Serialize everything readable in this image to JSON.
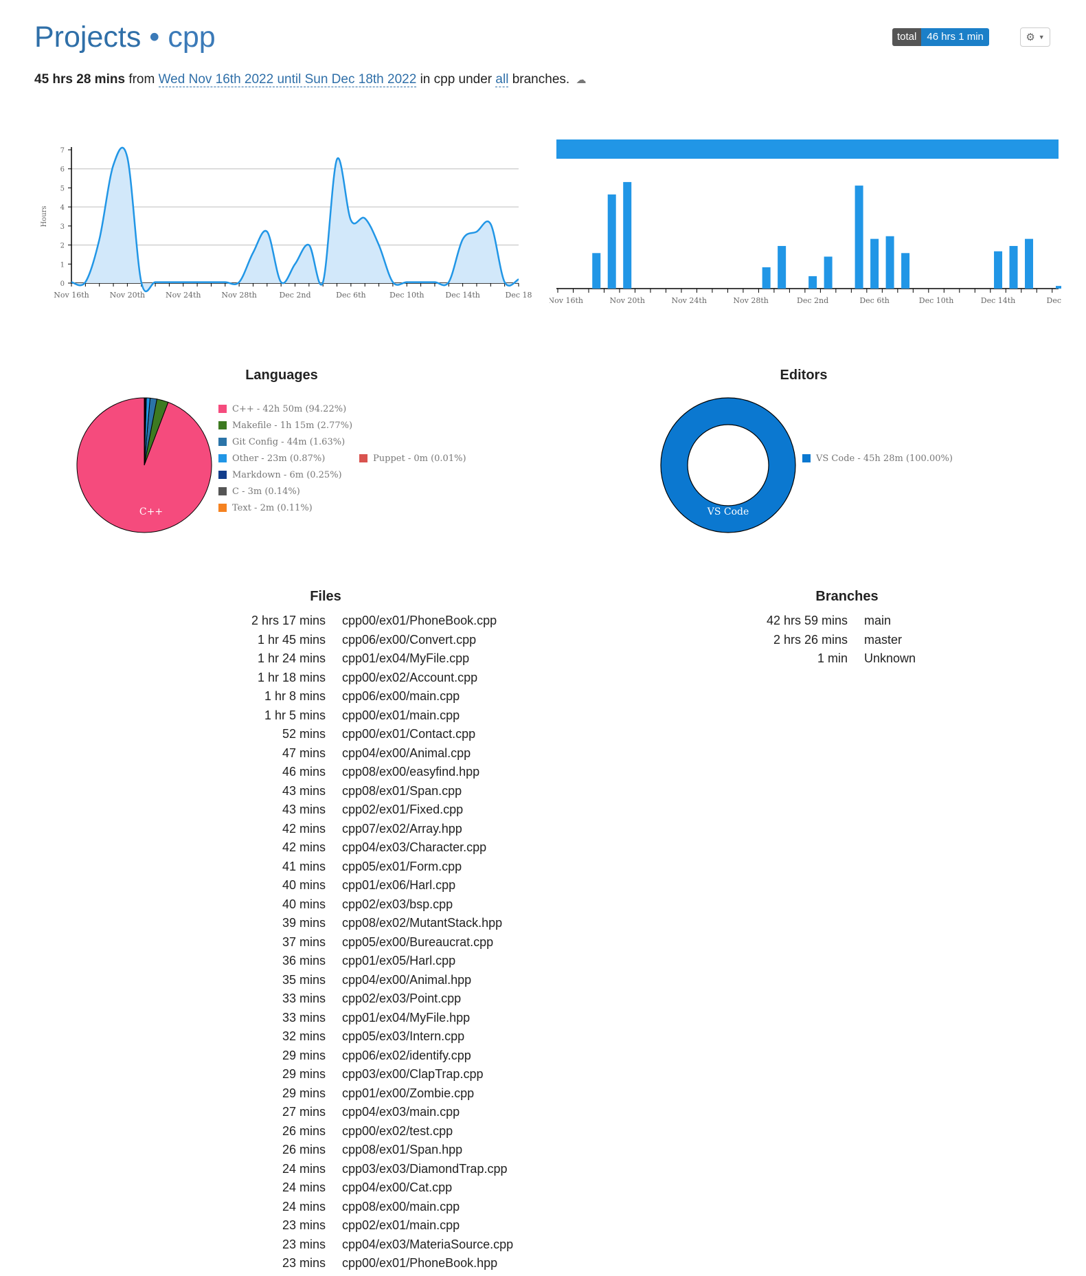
{
  "header": {
    "title_prefix": "Projects",
    "separator": "•",
    "project": "cpp",
    "total_label": "total",
    "total_value": "46 hrs 1 min"
  },
  "summary": {
    "duration": "45 hrs 28 mins",
    "from_word": "from",
    "range": "Wed Nov 16th 2022 until Sun Dec 18th 2022",
    "in_text": "in cpp under",
    "branches_link": "all",
    "tail": "branches."
  },
  "chart_data": [
    {
      "type": "area",
      "ylabel": "Hours",
      "ylim": [
        0,
        7
      ],
      "yticks": [
        0,
        1,
        2,
        3,
        4,
        5,
        6,
        7
      ],
      "x_tick_labels": [
        "Nov 16th",
        "Nov 20th",
        "Nov 24th",
        "Nov 28th",
        "Dec 2nd",
        "Dec 6th",
        "Dec 10th",
        "Dec 14th",
        "Dec 18"
      ],
      "x": [
        "Nov 16",
        "Nov 17",
        "Nov 18",
        "Nov 19",
        "Nov 20",
        "Nov 21",
        "Nov 22",
        "Nov 23",
        "Nov 24",
        "Nov 25",
        "Nov 26",
        "Nov 27",
        "Nov 28",
        "Nov 29",
        "Nov 30",
        "Dec 1",
        "Dec 2",
        "Dec 3",
        "Dec 4",
        "Dec 5",
        "Dec 6",
        "Dec 7",
        "Dec 8",
        "Dec 9",
        "Dec 10",
        "Dec 11",
        "Dec 12",
        "Dec 13",
        "Dec 14",
        "Dec 15",
        "Dec 16",
        "Dec 17",
        "Dec 18"
      ],
      "values": [
        0.05,
        0.05,
        2.3,
        6.2,
        6.6,
        0.05,
        0.05,
        0.05,
        0.05,
        0.05,
        0.05,
        0.05,
        0.05,
        1.6,
        2.7,
        0.05,
        1.0,
        2.0,
        0.05,
        6.5,
        3.3,
        3.4,
        2.0,
        0.05,
        0.05,
        0.05,
        0.05,
        0.05,
        2.3,
        2.7,
        3.1,
        0.05,
        0.2
      ],
      "grid": true,
      "color": "#2196e6",
      "fill": "#d2e8fa"
    },
    {
      "type": "bar",
      "x_tick_labels": [
        "Nov 16th",
        "Nov 20th",
        "Nov 24th",
        "Nov 28th",
        "Dec 2nd",
        "Dec 6th",
        "Dec 10th",
        "Dec 14th",
        "Dec 18"
      ],
      "x": [
        "Nov 16",
        "Nov 17",
        "Nov 18",
        "Nov 19",
        "Nov 20",
        "Nov 21",
        "Nov 22",
        "Nov 23",
        "Nov 24",
        "Nov 25",
        "Nov 26",
        "Nov 27",
        "Nov 28",
        "Nov 29",
        "Nov 30",
        "Dec 1",
        "Dec 2",
        "Dec 3",
        "Dec 4",
        "Dec 5",
        "Dec 6",
        "Dec 7",
        "Dec 8",
        "Dec 9",
        "Dec 10",
        "Dec 11",
        "Dec 12",
        "Dec 13",
        "Dec 14",
        "Dec 15",
        "Dec 16",
        "Dec 17",
        "Dec 18"
      ],
      "values": [
        0,
        0,
        2.0,
        5.3,
        6.0,
        0,
        0,
        0,
        0,
        0,
        0,
        0,
        0,
        1.2,
        2.4,
        0,
        0.7,
        1.8,
        0,
        5.8,
        2.8,
        2.95,
        2.0,
        0,
        0,
        0,
        0,
        0,
        2.1,
        2.4,
        2.8,
        0,
        0.15
      ],
      "ylim": [
        0,
        6.5
      ],
      "color": "#2196e6"
    },
    {
      "type": "pie",
      "title": "Languages",
      "slice_label": "C++",
      "labels": [
        "C++ - 42h 50m (94.22%)",
        "Makefile - 1h 15m (2.77%)",
        "Git Config - 44m (1.63%)",
        "Other - 23m (0.87%)",
        "Markdown - 6m (0.25%)",
        "C - 3m (0.14%)",
        "Text - 2m (0.11%)",
        "Puppet - 0m (0.01%)"
      ],
      "values": [
        94.22,
        2.77,
        1.63,
        0.87,
        0.25,
        0.14,
        0.11,
        0.01
      ],
      "colors": [
        "#f54b7d",
        "#3d7a21",
        "#2b74a8",
        "#2196e6",
        "#123e8c",
        "#555555",
        "#f58220",
        "#d9534f"
      ]
    },
    {
      "type": "pie",
      "title": "Editors",
      "slice_label": "VS Code",
      "labels": [
        "VS Code - 45h 28m (100.00%)"
      ],
      "values": [
        100.0
      ],
      "colors": [
        "#0b78d0"
      ]
    }
  ],
  "files": {
    "title": "Files",
    "rows": [
      {
        "duration": "2 hrs 17 mins",
        "name": "cpp00/ex01/PhoneBook.cpp"
      },
      {
        "duration": "1 hr 45 mins",
        "name": "cpp06/ex00/Convert.cpp"
      },
      {
        "duration": "1 hr 24 mins",
        "name": "cpp01/ex04/MyFile.cpp"
      },
      {
        "duration": "1 hr 18 mins",
        "name": "cpp00/ex02/Account.cpp"
      },
      {
        "duration": "1 hr 8 mins",
        "name": "cpp06/ex00/main.cpp"
      },
      {
        "duration": "1 hr 5 mins",
        "name": "cpp00/ex01/main.cpp"
      },
      {
        "duration": "52 mins",
        "name": "cpp00/ex01/Contact.cpp"
      },
      {
        "duration": "47 mins",
        "name": "cpp04/ex00/Animal.cpp"
      },
      {
        "duration": "46 mins",
        "name": "cpp08/ex00/easyfind.hpp"
      },
      {
        "duration": "43 mins",
        "name": "cpp08/ex01/Span.cpp"
      },
      {
        "duration": "43 mins",
        "name": "cpp02/ex01/Fixed.cpp"
      },
      {
        "duration": "42 mins",
        "name": "cpp07/ex02/Array.hpp"
      },
      {
        "duration": "42 mins",
        "name": "cpp04/ex03/Character.cpp"
      },
      {
        "duration": "41 mins",
        "name": "cpp05/ex01/Form.cpp"
      },
      {
        "duration": "40 mins",
        "name": "cpp01/ex06/Harl.cpp"
      },
      {
        "duration": "40 mins",
        "name": "cpp02/ex03/bsp.cpp"
      },
      {
        "duration": "39 mins",
        "name": "cpp08/ex02/MutantStack.hpp"
      },
      {
        "duration": "37 mins",
        "name": "cpp05/ex00/Bureaucrat.cpp"
      },
      {
        "duration": "36 mins",
        "name": "cpp01/ex05/Harl.cpp"
      },
      {
        "duration": "35 mins",
        "name": "cpp04/ex00/Animal.hpp"
      },
      {
        "duration": "33 mins",
        "name": "cpp02/ex03/Point.cpp"
      },
      {
        "duration": "33 mins",
        "name": "cpp01/ex04/MyFile.hpp"
      },
      {
        "duration": "32 mins",
        "name": "cpp05/ex03/Intern.cpp"
      },
      {
        "duration": "29 mins",
        "name": "cpp06/ex02/identify.cpp"
      },
      {
        "duration": "29 mins",
        "name": "cpp03/ex00/ClapTrap.cpp"
      },
      {
        "duration": "29 mins",
        "name": "cpp01/ex00/Zombie.cpp"
      },
      {
        "duration": "27 mins",
        "name": "cpp04/ex03/main.cpp"
      },
      {
        "duration": "26 mins",
        "name": "cpp00/ex02/test.cpp"
      },
      {
        "duration": "26 mins",
        "name": "cpp08/ex01/Span.hpp"
      },
      {
        "duration": "24 mins",
        "name": "cpp03/ex03/DiamondTrap.cpp"
      },
      {
        "duration": "24 mins",
        "name": "cpp04/ex00/Cat.cpp"
      },
      {
        "duration": "24 mins",
        "name": "cpp08/ex00/main.cpp"
      },
      {
        "duration": "23 mins",
        "name": "cpp02/ex01/main.cpp"
      },
      {
        "duration": "23 mins",
        "name": "cpp04/ex03/MateriaSource.cpp"
      },
      {
        "duration": "23 mins",
        "name": "cpp00/ex01/PhoneBook.hpp"
      }
    ]
  },
  "branches": {
    "title": "Branches",
    "rows": [
      {
        "duration": "42 hrs 59 mins",
        "name": "main"
      },
      {
        "duration": "2 hrs 26 mins",
        "name": "master"
      },
      {
        "duration": "1 min",
        "name": "Unknown"
      }
    ]
  },
  "icons": {
    "settings": "gear-icon",
    "caret": "caret-down-icon",
    "cloud": "cloud-download-icon"
  }
}
